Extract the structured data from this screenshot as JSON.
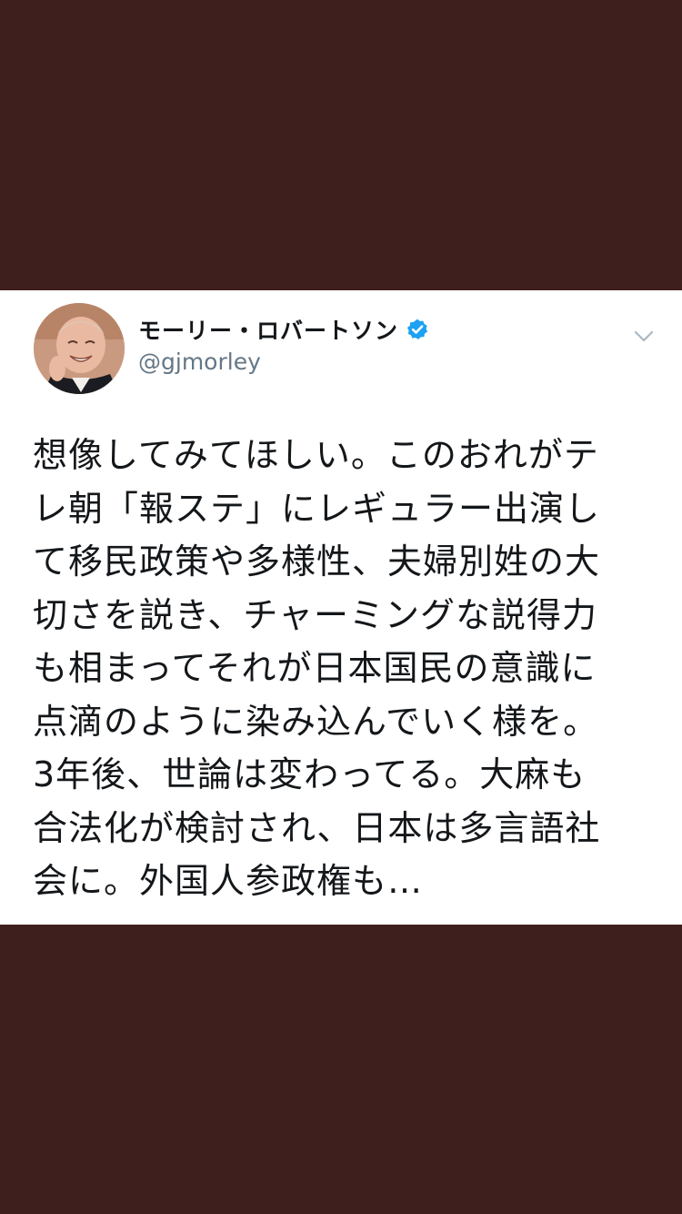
{
  "tweet": {
    "author": {
      "display_name": "モーリー・ロバートソン",
      "handle": "@gjmorley",
      "verified": true,
      "avatar_icon": "profile-photo-icon"
    },
    "menu_icon": "chevron-down-icon",
    "text_lines": [
      "想像してみてほしい。このおれがテ",
      "レ朝「報ステ」にレギュラー出演し",
      "て移民政策や多様性、夫婦別姓の大",
      "切さを説き、チャーミングな説得力",
      "も相まってそれが日本国民の意識に",
      "点滴のように染み込んでいく様を。",
      "3年後、世論は変わってる。大麻も",
      "合法化が検討され、日本は多言語社",
      "会に。外国人参政権も…"
    ]
  },
  "colors": {
    "background": "#3e1f1e",
    "card": "#ffffff",
    "text": "#14171a",
    "secondary_text": "#657786",
    "verified_blue": "#1da1f2"
  }
}
